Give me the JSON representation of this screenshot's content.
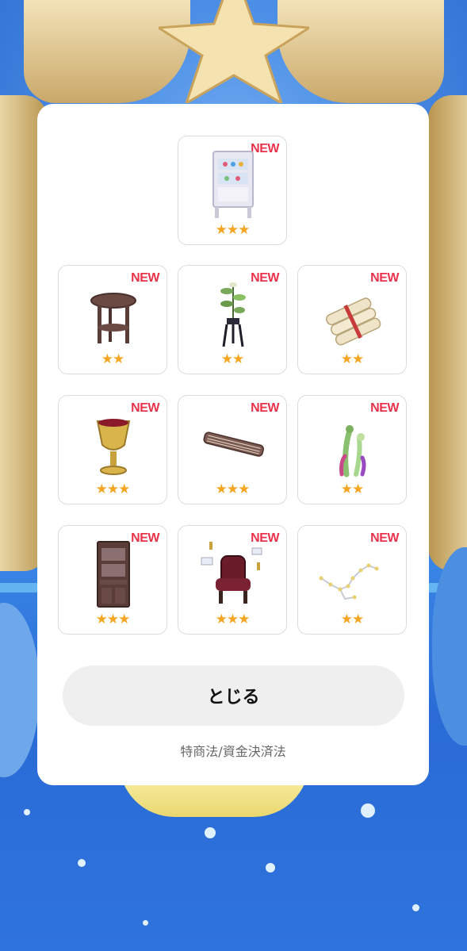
{
  "items": [
    {
      "name": "glass-cabinet",
      "badge": "NEW",
      "stars": "★★★",
      "rarity": 3
    },
    {
      "name": "round-side-table",
      "badge": "NEW",
      "stars": "★★",
      "rarity": 2
    },
    {
      "name": "potted-plant-stand",
      "badge": "NEW",
      "stars": "★★",
      "rarity": 2
    },
    {
      "name": "rolled-scrolls",
      "badge": "NEW",
      "stars": "★★",
      "rarity": 2
    },
    {
      "name": "golden-goblet",
      "badge": "NEW",
      "stars": "★★★",
      "rarity": 3
    },
    {
      "name": "koto-harp",
      "badge": "NEW",
      "stars": "★★★",
      "rarity": 3
    },
    {
      "name": "coral-seaweed",
      "badge": "NEW",
      "stars": "★★",
      "rarity": 2
    },
    {
      "name": "wooden-bookshelf",
      "badge": "NEW",
      "stars": "★★★",
      "rarity": 3
    },
    {
      "name": "velvet-armchair",
      "badge": "NEW",
      "stars": "★★★",
      "rarity": 3
    },
    {
      "name": "constellation-lights",
      "badge": "NEW",
      "stars": "★★",
      "rarity": 2
    }
  ],
  "close_label": "とじる",
  "legal_link_label": "特商法/資金決済法",
  "colors": {
    "new_badge": "#e8334b",
    "star": "#f4a623",
    "button_bg": "#efefef"
  }
}
